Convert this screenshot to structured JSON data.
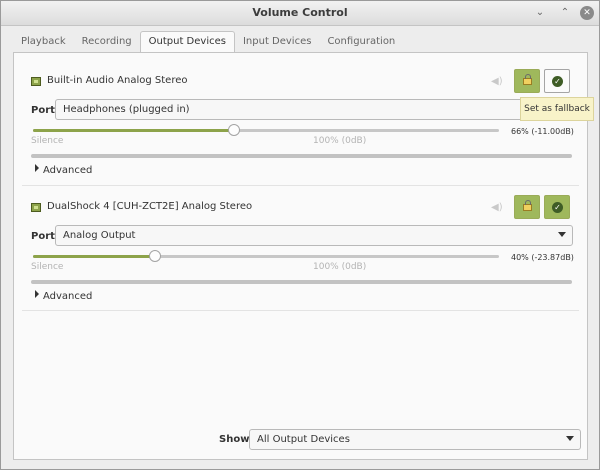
{
  "window": {
    "title": "Volume Control",
    "controls": {
      "minimize": "⌄",
      "maximize": "⌃",
      "close": "✕"
    }
  },
  "tabs": [
    {
      "label": "Playback",
      "active": false
    },
    {
      "label": "Recording",
      "active": false
    },
    {
      "label": "Output Devices",
      "active": true
    },
    {
      "label": "Input Devices",
      "active": false
    },
    {
      "label": "Configuration",
      "active": false
    }
  ],
  "devices": [
    {
      "name": "Built-in Audio Analog Stereo",
      "port_label": "Port:",
      "port_value": "Headphones (plugged in)",
      "volume_fraction": 0.66,
      "volume_text": "66% (-11.00dB)",
      "scale_silence": "Silence",
      "scale_100": "100% (0dB)",
      "expander_label": "Advanced",
      "lock_active": true,
      "fallback_active": false,
      "icons": {
        "device": "sound-card-icon",
        "mute": "speaker-icon",
        "lock": "lock-icon",
        "fallback": "check-icon"
      }
    },
    {
      "name": "DualShock 4 [CUH-ZCT2E] Analog Stereo",
      "port_label": "Port:",
      "port_value": "Analog Output",
      "volume_fraction": 0.4,
      "volume_text": "40% (-23.87dB)",
      "scale_silence": "Silence",
      "scale_100": "100% (0dB)",
      "expander_label": "Advanced",
      "lock_active": true,
      "fallback_active": true,
      "icons": {
        "device": "sound-card-icon",
        "mute": "speaker-icon",
        "lock": "lock-icon",
        "fallback": "check-icon"
      }
    }
  ],
  "tooltip": {
    "text": "Set as fallback"
  },
  "footer": {
    "show_label": "Show:",
    "show_value": "All Output Devices"
  },
  "colors": {
    "accent": "#8da34a",
    "toggle_on": "#9fb85c",
    "tooltip_bg": "#f8f3c9"
  }
}
